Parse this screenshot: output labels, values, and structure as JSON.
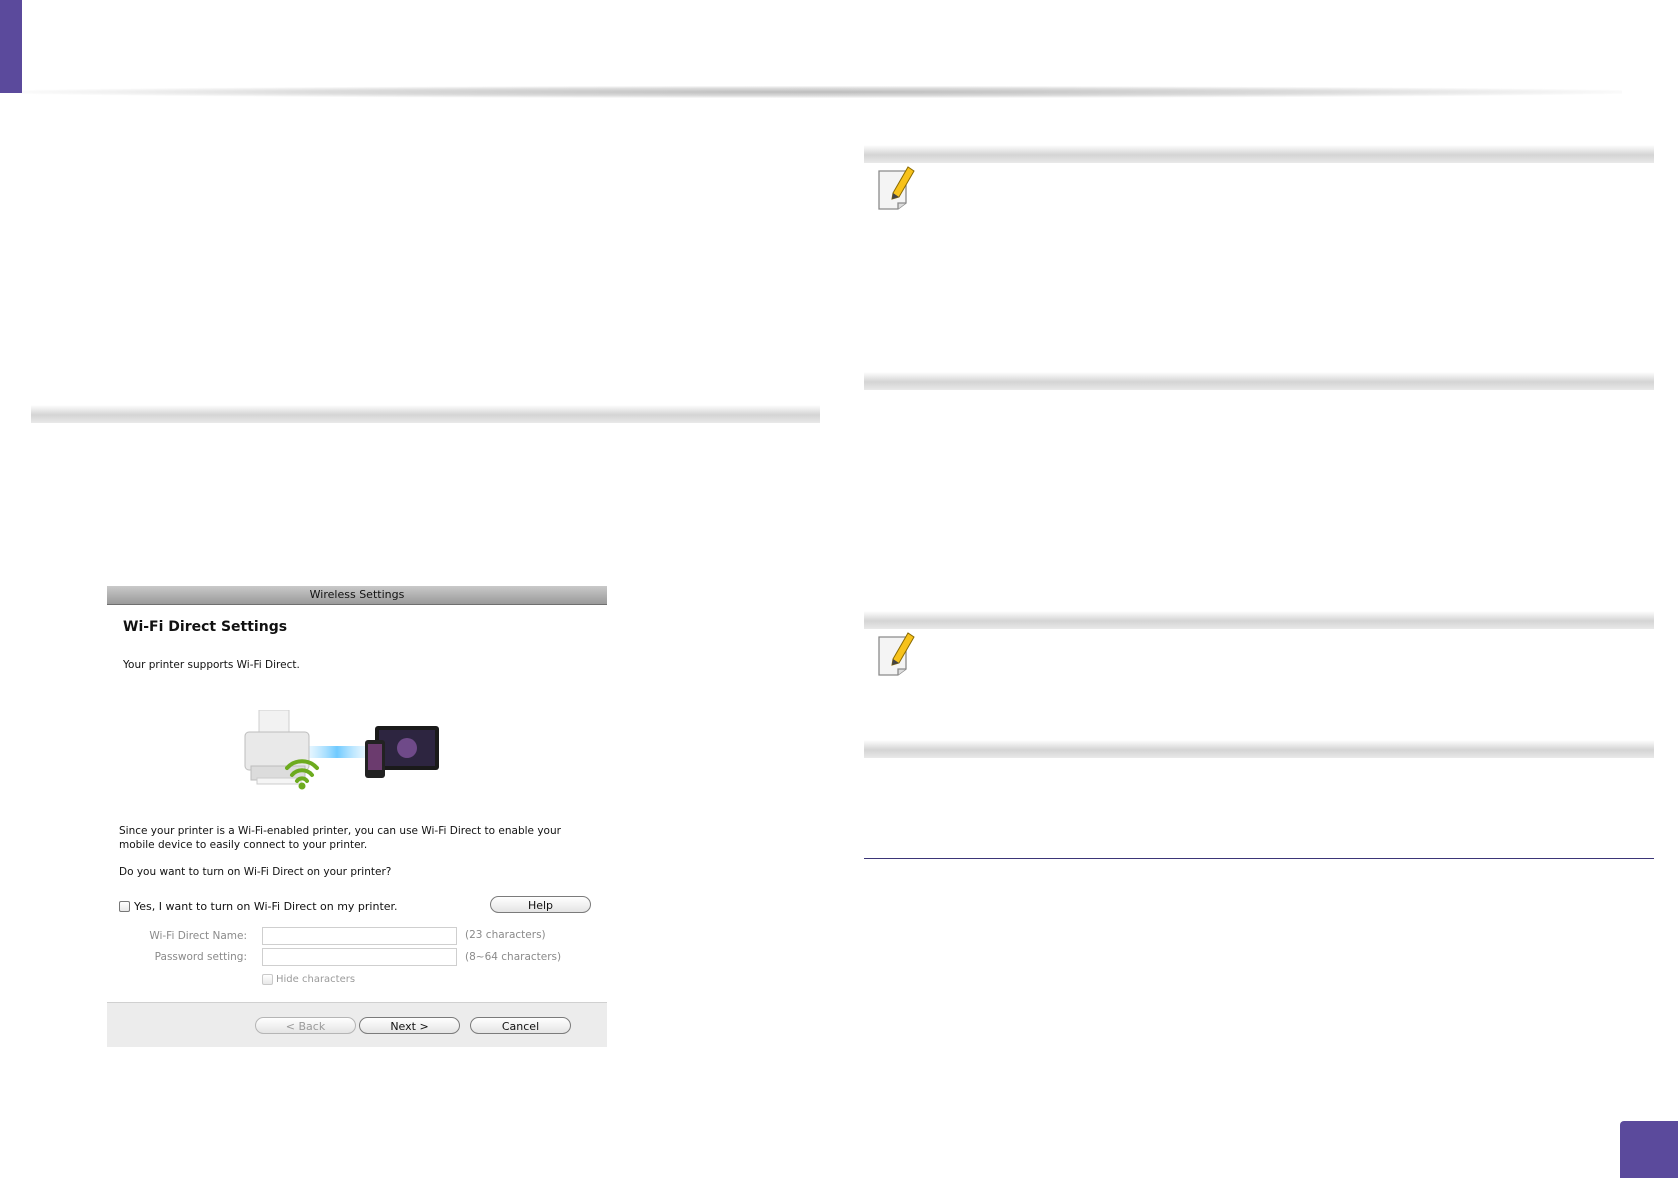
{
  "dialog": {
    "title": "Wireless Settings",
    "heading": "Wi-Fi Direct Settings",
    "supports_text": "Your printer supports Wi-Fi Direct.",
    "description": "Since your printer is a Wi-Fi-enabled printer, you can use Wi-Fi Direct to enable your mobile device to easily connect to your printer.",
    "question": "Do you want to turn on Wi-Fi Direct on your printer?",
    "enable_checkbox_label": "Yes, I want to turn on Wi-Fi Direct on my printer.",
    "enable_checked": false,
    "help_button": "Help",
    "fields": [
      {
        "label": "Wi-Fi Direct Name:",
        "value": "",
        "hint": "(23 characters)"
      },
      {
        "label": "Password setting:",
        "value": "",
        "hint": "(8~64 characters)"
      }
    ],
    "hide_characters_label": "Hide characters",
    "buttons": {
      "back": "< Back",
      "next": "Next >",
      "cancel": "Cancel"
    }
  },
  "icons": {
    "note": "note-pencil-icon",
    "printer": "printer-icon",
    "wifi": "wifi-icon",
    "mobile": "mobile-devices-icon"
  },
  "colors": {
    "accent": "#5b4a9c",
    "rule": "#3b3577",
    "wifi_green": "#6dab1f"
  }
}
